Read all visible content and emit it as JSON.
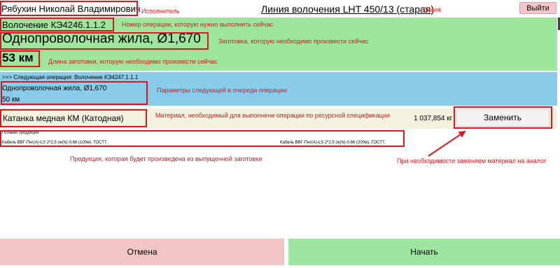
{
  "header": {
    "worker_name": "Рябухин Николай Владимирович",
    "line_title": "Линия волочения LHT 450/13 (старая)",
    "exit_label": "Выйти"
  },
  "operation": {
    "code": "Волочение КЭ4246.1.1.2",
    "blank_name": "Однопроволочная жила, Ø1,670",
    "blank_length": "53 км"
  },
  "next_operation": {
    "caption": ">>> Следующая операция: Волочение КЭ4247.1.1.1",
    "blank_name": "Однопроволочная жила, Ø1,670",
    "blank_length": "50 км"
  },
  "material": {
    "name": "Катанка медная КМ (Катодная)",
    "quantity": "1 037,854 кг",
    "replace_label": "Заменить"
  },
  "products": {
    "caption": "Готовая продукция:",
    "items": [
      "Кабель ВВГ-Пнг(А)-LS 2*2,5 ок(N)-0,66 (100м), ГОСТ7,",
      "Кабель ВВГ-Пнг(А)-LS 2*2,5 ок(N)-0,66 (200м), ГОСТ7,"
    ]
  },
  "footer": {
    "cancel_label": "Отмена",
    "start_label": "Начать"
  },
  "annotations": {
    "worker": "Исполнитель",
    "line": "Линия",
    "operation_code": "Номер операции, которую нужно выполнить сейчас",
    "blank": "Заготовка, которую необходимо произвести сейчас",
    "length": "Длина заготовки, которую необходимо произвести сейчас",
    "next_params": "Параметры следующей в очереди операции",
    "material": "Материал, необходимый для выполнени операции по ресурсной спецификации",
    "products": "Продукция, которая будет произведена из выпущенной заготовки",
    "replace": "При необходимости заменяем материал на аналог"
  },
  "colors": {
    "operation_panel": "#9ee69b",
    "next_panel": "#88ccea",
    "material_row": "#f2f2df",
    "cancel_button": "#f2c4c4",
    "start_button": "#9ee6a0",
    "exit_button": "#f5c6cb",
    "annotation_red": "#e0141e"
  }
}
